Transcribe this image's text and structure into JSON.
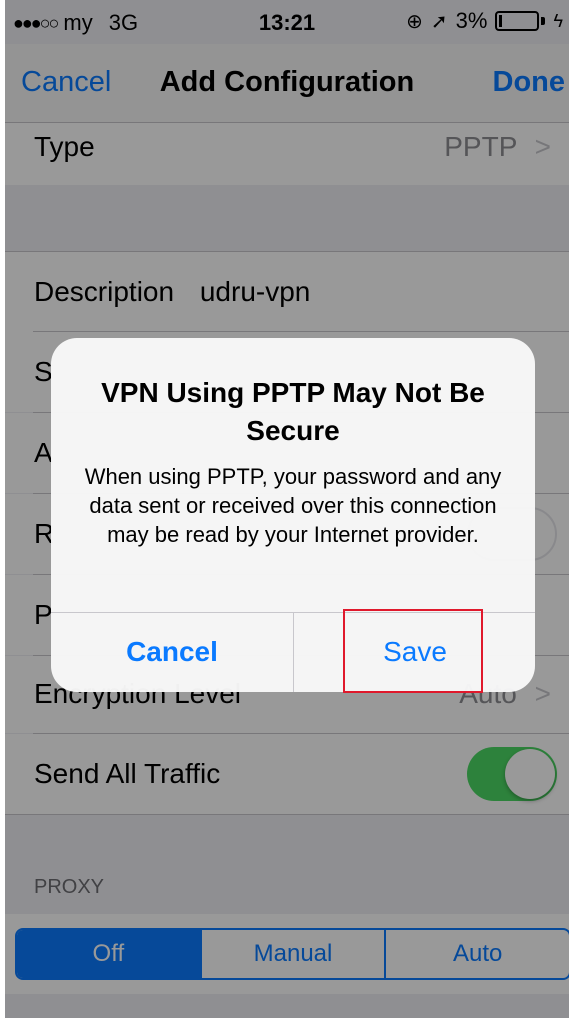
{
  "status_bar": {
    "carrier": "my",
    "network": "3G",
    "time": "13:21",
    "battery": "3%"
  },
  "nav": {
    "cancel_label": "Cancel",
    "title": "Add Configuration",
    "done_label": "Done"
  },
  "rows": {
    "type_label": "Type",
    "type_value": "PPTP",
    "description_label": "Description",
    "description_value": "udru-vpn",
    "server_label_partial": "S",
    "account_label_partial": "A",
    "rsa_label_partial": "R",
    "password_label_partial": "P",
    "encryption_label": "Encryption Level",
    "encryption_value": "Auto",
    "send_all_traffic_label": "Send All Traffic"
  },
  "proxy": {
    "header": "PROXY",
    "options": [
      "Off",
      "Manual",
      "Auto"
    ],
    "selected": "Off"
  },
  "alert": {
    "title": "VPN Using PPTP May Not Be Secure",
    "message": "When using PPTP, your password and any data sent or received over this connection may be read by your Internet provider.",
    "cancel_label": "Cancel",
    "save_label": "Save"
  },
  "colors": {
    "accent": "#0a7aff",
    "toggle_on": "#4cd964",
    "highlight": "#e0192c"
  }
}
